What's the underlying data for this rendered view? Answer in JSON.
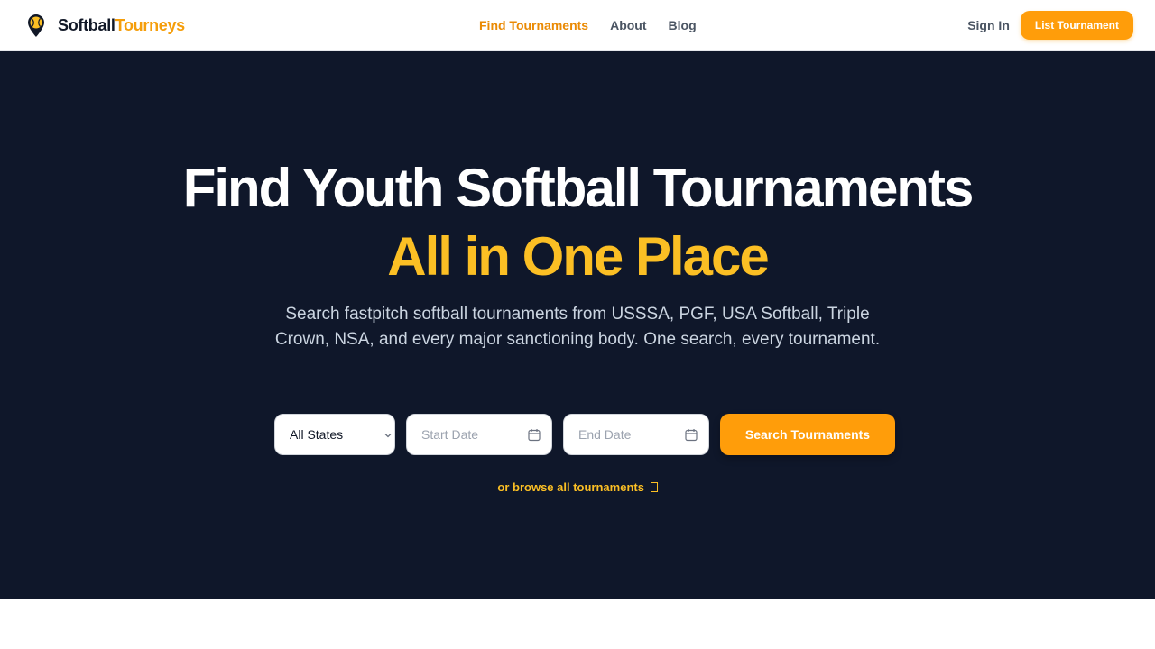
{
  "brand": {
    "name_primary": "Softball",
    "name_accent": "Tourneys"
  },
  "nav": {
    "links": [
      {
        "label": "Find Tournaments",
        "active": true
      },
      {
        "label": "About",
        "active": false
      },
      {
        "label": "Blog",
        "active": false
      }
    ],
    "sign_in": "Sign In",
    "cta": "List Tournament"
  },
  "hero": {
    "title_line1": "Find Youth Softball Tournaments",
    "title_line2": "All in One Place",
    "subtitle": "Search fastpitch softball tournaments from USSSA, PGF, USA Softball, Triple Crown, NSA, and every major sanctioning body. One search, every tournament."
  },
  "search": {
    "state_selected": "All States",
    "start_date_placeholder": "Start Date",
    "end_date_placeholder": "End Date",
    "button_label": "Search Tournaments",
    "browse_link": "or browse all tournaments"
  },
  "colors": {
    "accent": "#ff9d0a",
    "accent_text": "#fbbf24",
    "hero_bg": "#0f172a",
    "brand_dark": "#111827"
  },
  "icons": {
    "brand": "softball-pin-icon",
    "calendar": "calendar-icon",
    "chevron": "chevron-down-icon",
    "browse_arrow": "arrow-right-icon"
  }
}
